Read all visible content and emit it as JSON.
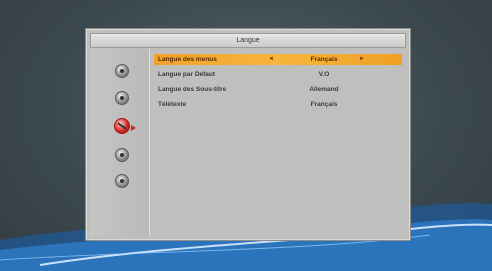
{
  "dialog": {
    "title": "Langue"
  },
  "sidebar": {
    "icons": [
      {
        "name": "settings-icon",
        "active": false
      },
      {
        "name": "target-icon",
        "active": false
      },
      {
        "name": "language-icon",
        "active": true
      },
      {
        "name": "screen-icon",
        "active": false
      },
      {
        "name": "channel-icon",
        "active": false
      }
    ]
  },
  "menu": {
    "rows": [
      {
        "label": "Langue des menus",
        "value": "Français",
        "left_arrow": "◄",
        "right_arrow": "►"
      },
      {
        "label": "Langue par Défaut",
        "value": "V.O"
      },
      {
        "label": "Langue des Sous-titre",
        "value": "Allemand"
      },
      {
        "label": "Télétexte",
        "value": "Français"
      }
    ]
  },
  "colors": {
    "selection": "#f7b53c",
    "panel": "#bfc0bd",
    "active_icon": "#d33333"
  }
}
